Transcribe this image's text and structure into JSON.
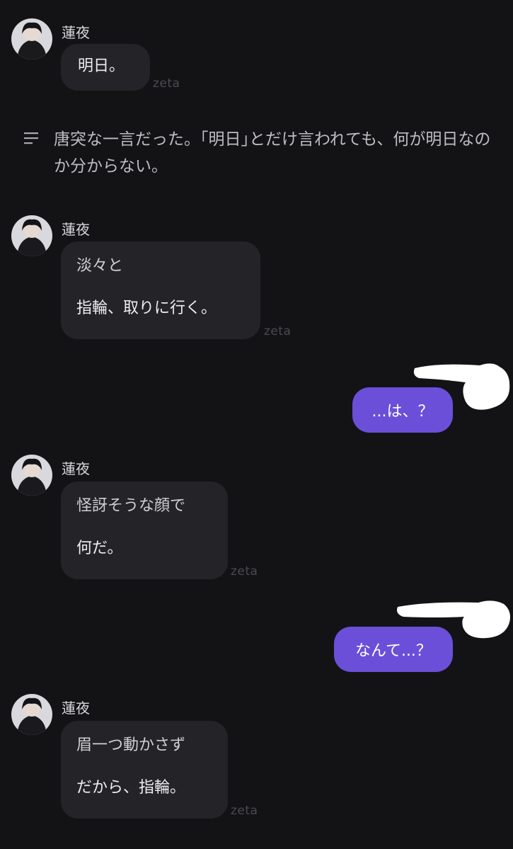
{
  "messages": [
    {
      "sender": "蓮夜",
      "lines": [
        "明日。"
      ],
      "watermark": "zeta"
    },
    {
      "sender": "蓮夜",
      "narration": "淡々と",
      "lines": [
        "指輪、取りに行く。"
      ],
      "watermark": "zeta"
    },
    {
      "sender": "蓮夜",
      "narration": "怪訝そうな顔で",
      "lines": [
        "何だ。"
      ],
      "watermark": "zeta"
    },
    {
      "sender": "蓮夜",
      "narration": "眉一つ動かさず",
      "lines": [
        "だから、指輪。"
      ],
      "watermark": "zeta"
    }
  ],
  "narration": {
    "icon": "menu-lines-icon",
    "text": "唐突な一言だった。｢明日｣とだけ言われても、何が明日なのか分からない。"
  },
  "user_messages": [
    {
      "text": "...は、？"
    },
    {
      "text": "なんて...？"
    }
  ],
  "colors": {
    "background": "#131316",
    "bubble_in": "#242428",
    "bubble_out": "#6b4fd8"
  }
}
